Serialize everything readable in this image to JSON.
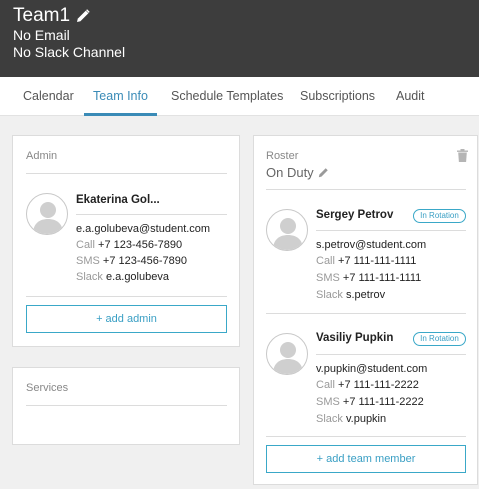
{
  "header": {
    "team_name": "Team1",
    "email": "No Email",
    "slack": "No Slack Channel"
  },
  "tabs": [
    {
      "label": "Calendar"
    },
    {
      "label": "Team Info"
    },
    {
      "label": "Schedule Templates"
    },
    {
      "label": "Subscriptions"
    },
    {
      "label": "Audit"
    }
  ],
  "active_tab": "Team Info",
  "admin": {
    "section_label": "Admin",
    "person": {
      "name": "Ekaterina Gol...",
      "email": "e.a.golubeva@student.com",
      "call_label": "Call",
      "call": "+7 123-456-7890",
      "sms_label": "SMS",
      "sms": "+7 123-456-7890",
      "slack_label": "Slack",
      "slack": "e.a.golubeva"
    },
    "add_button": "+ add admin"
  },
  "services": {
    "section_label": "Services"
  },
  "roster": {
    "section_label": "Roster",
    "name": "On Duty",
    "members": [
      {
        "name": "Sergey Petrov",
        "badge": "In Rotation",
        "email": "s.petrov@student.com",
        "call_label": "Call",
        "call": "+7 111-111-1111",
        "sms_label": "SMS",
        "sms": "+7 111-111-1111",
        "slack_label": "Slack",
        "slack": "s.petrov"
      },
      {
        "name": "Vasiliy Pupkin",
        "badge": "In Rotation",
        "email": "v.pupkin@student.com",
        "call_label": "Call",
        "call": "+7 111-111-2222",
        "sms_label": "SMS",
        "sms": "+7 111-111-2222",
        "slack_label": "Slack",
        "slack": "v.pupkin"
      }
    ],
    "add_button": "+ add team member"
  },
  "icons": {
    "edit": "pencil-icon",
    "delete": "trash-icon",
    "avatar": "user-silhouette-icon"
  },
  "colors": {
    "header_bg": "#3d3d3d",
    "accent": "#3a8bb7",
    "button_border": "#3aa8c8"
  }
}
